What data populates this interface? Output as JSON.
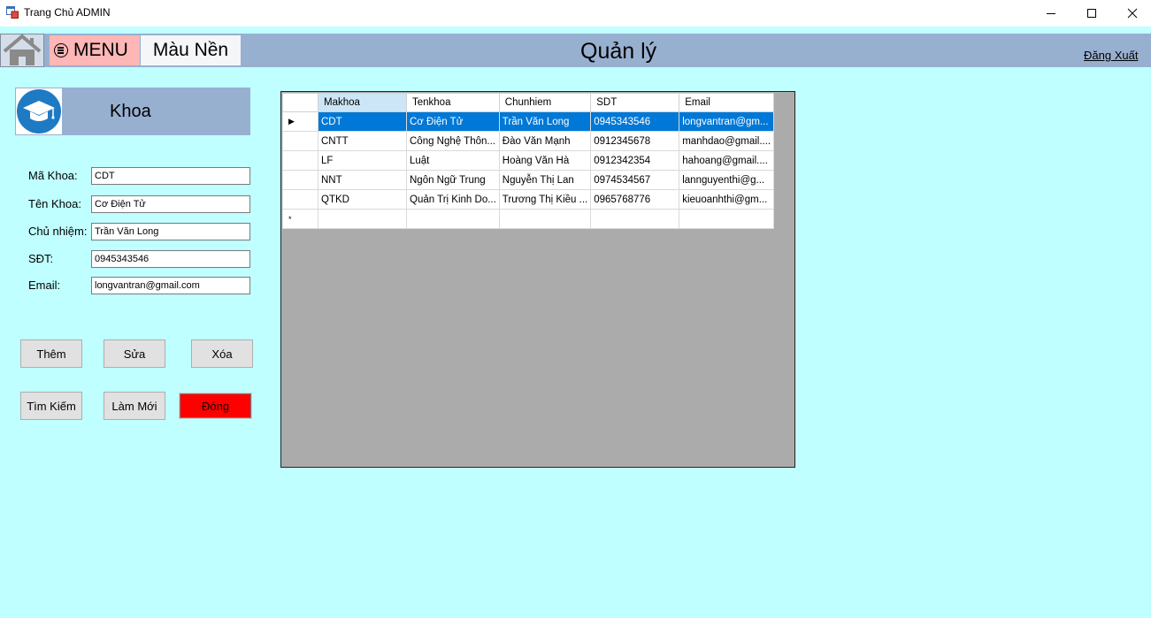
{
  "window": {
    "title": "Trang Chủ ADMIN"
  },
  "header": {
    "menu_label": "MENU",
    "background_label": "Màu Nền",
    "page_title": "Quản lý",
    "logout_label": "Đăng Xuất"
  },
  "khoa_banner": {
    "title": "Khoa"
  },
  "form": {
    "ma_khoa_label": "Mã Khoa:",
    "ma_khoa_value": "CDT",
    "ten_khoa_label": "Tên Khoa:",
    "ten_khoa_value": "Cơ Điện Tử",
    "chu_nhiem_label": "Chủ nhiệm:",
    "chu_nhiem_value": "Trần Văn Long",
    "sdt_label": "SĐT:",
    "sdt_value": "0945343546",
    "email_label": "Email:",
    "email_value": "longvantran@gmail.com"
  },
  "buttons": {
    "them": "Thêm",
    "sua": "Sửa",
    "xoa": "Xóa",
    "tim_kiem": "Tìm Kiếm",
    "lam_moi": "Làm Mới",
    "dong": "Đóng"
  },
  "grid": {
    "columns": [
      "Makhoa",
      "Tenkhoa",
      "Chunhiem",
      "SDT",
      "Email"
    ],
    "rows": [
      [
        "CDT",
        "Cơ Điện Tử",
        "Trần Văn Long",
        "0945343546",
        "longvantran@gm..."
      ],
      [
        "CNTT",
        "Công Nghệ Thôn...",
        "Đào Văn Mạnh",
        "0912345678",
        "manhdao@gmail...."
      ],
      [
        "LF",
        "Luật",
        "Hoàng Văn Hà",
        "0912342354",
        "hahoang@gmail...."
      ],
      [
        "NNT",
        "Ngôn Ngữ Trung",
        "Nguyễn Thị Lan",
        "0974534567",
        "lannguyenthi@g..."
      ],
      [
        "QTKD",
        "Quản Trị Kinh Do...",
        "Trương Thị Kiều ...",
        "0965768776",
        "kieuoanhthi@gm..."
      ]
    ],
    "new_row_marker": "*",
    "selected_row_marker": "▶",
    "selected_row": 0
  },
  "colors": {
    "background": "#c0ffff",
    "header": "#98b0d0",
    "menu_button": "#ffb6b6",
    "close_button": "#ff0000",
    "selection": "#0078d7"
  },
  "icons": {
    "app": "app-window-icon",
    "home": "home-icon",
    "menu": "menu-circle-icon",
    "khoa": "graduation-cap-icon"
  }
}
